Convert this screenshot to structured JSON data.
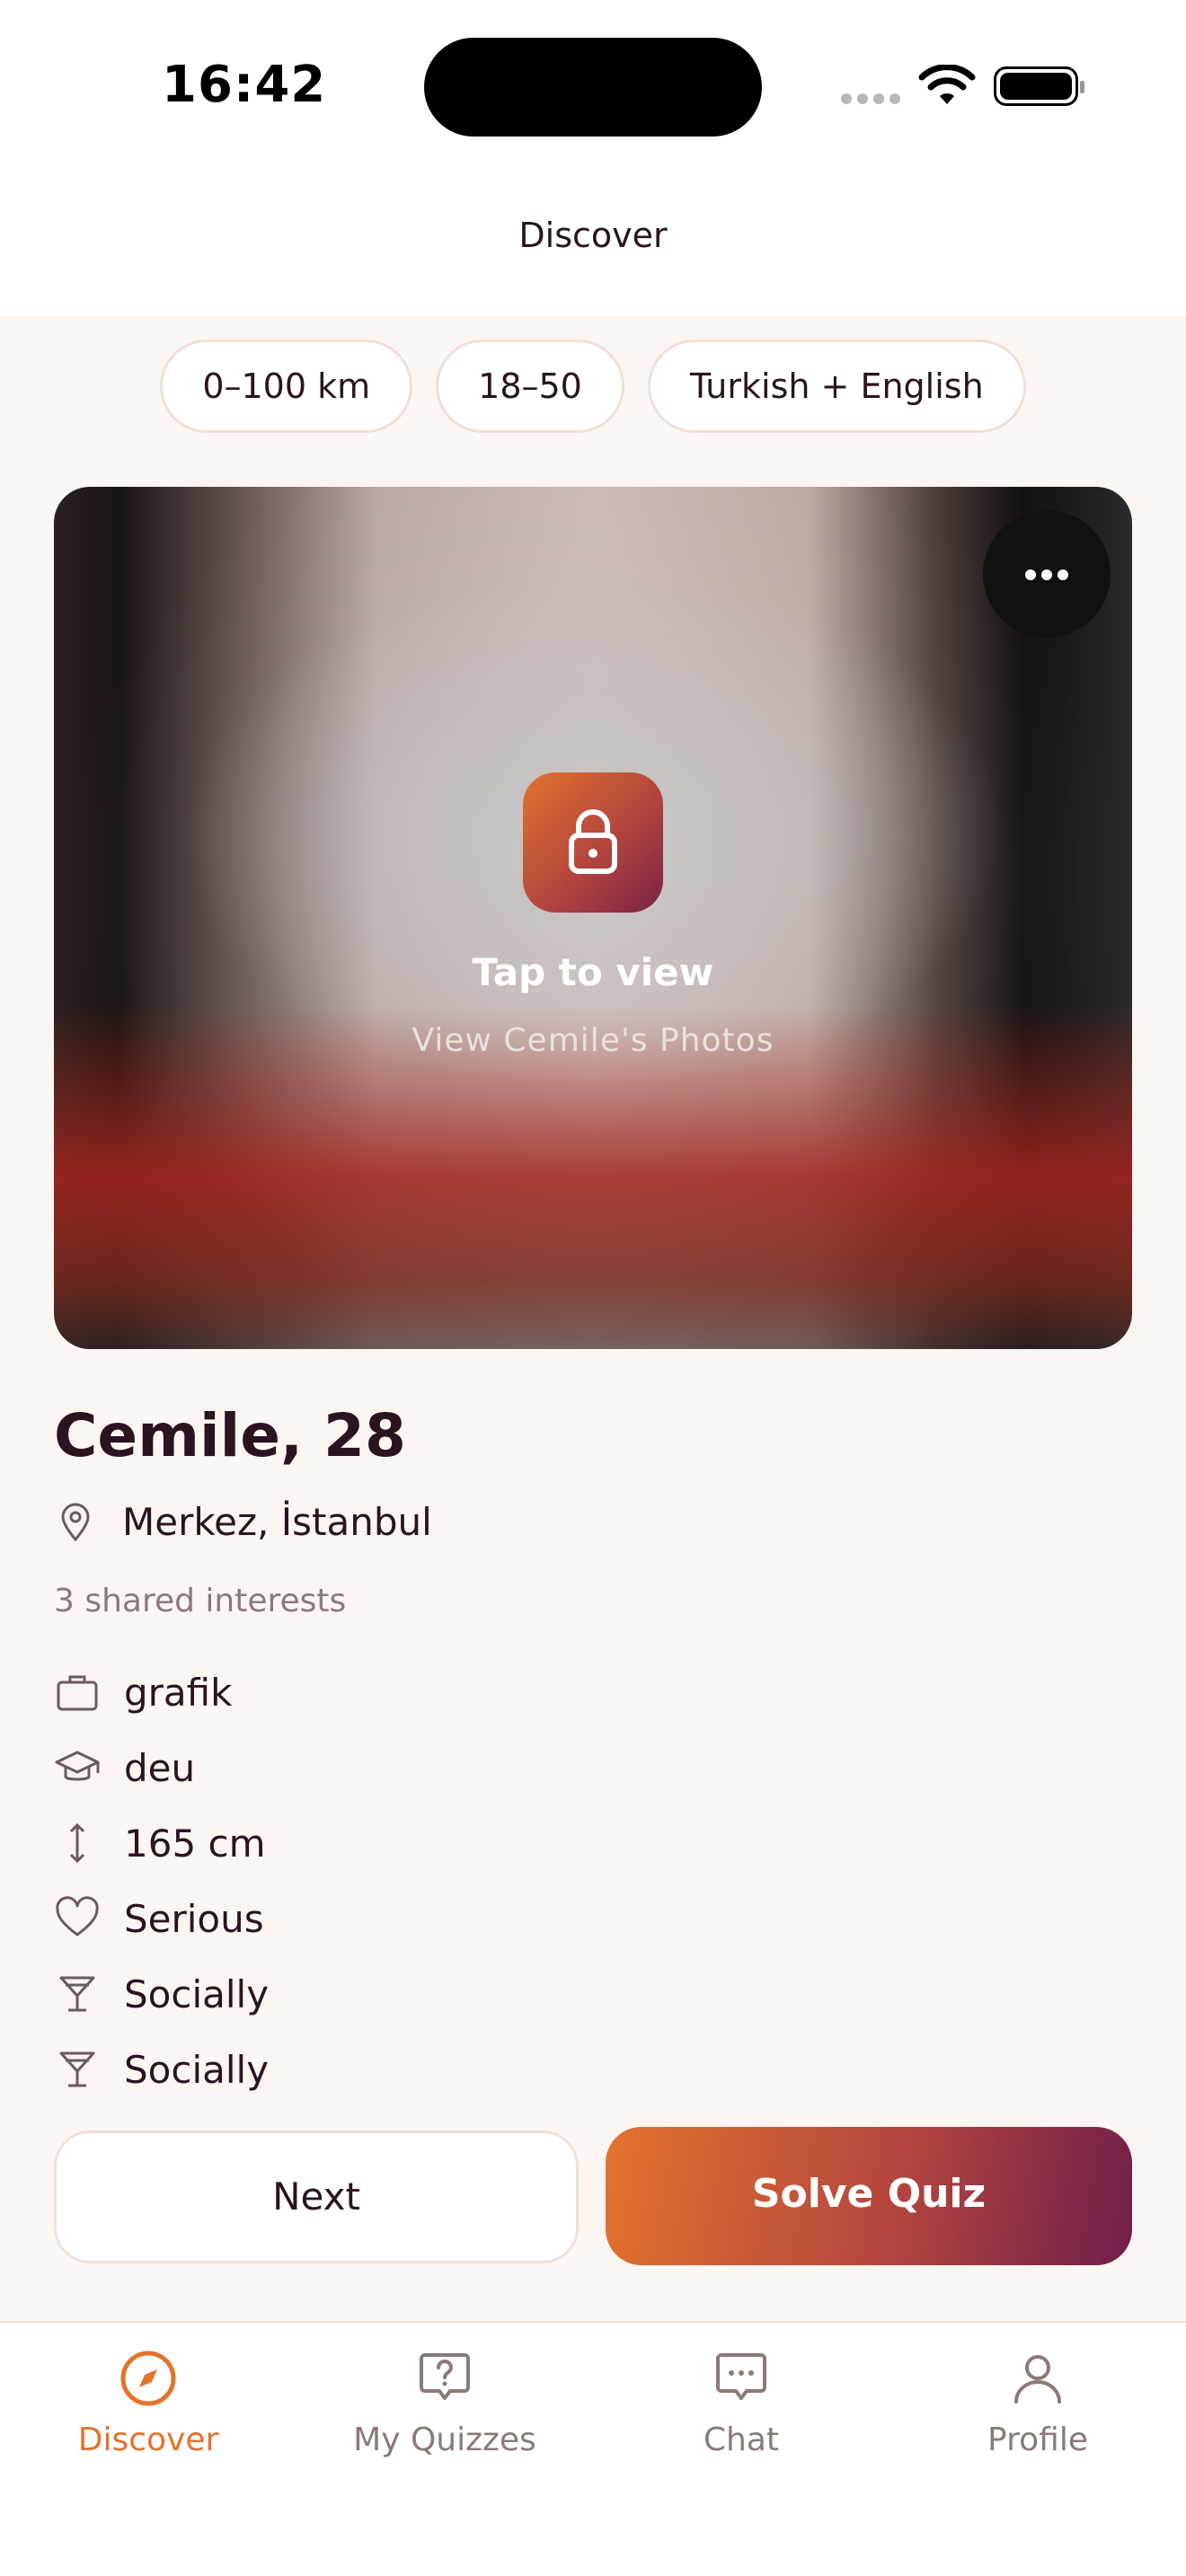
{
  "status_bar": {
    "time": "16:42"
  },
  "nav": {
    "title": "Discover"
  },
  "filters": [
    {
      "label": "0–100 km"
    },
    {
      "label": "18–50"
    },
    {
      "label": "Turkish + English"
    }
  ],
  "photo_card": {
    "locked_title": "Tap to view",
    "locked_subtitle": "View Cemile's Photos",
    "more_icon": "more-horizontal-icon",
    "lock_icon": "lock-icon"
  },
  "profile": {
    "name_age": "Cemile, 28",
    "location": "Merkez, İstanbul",
    "shared_interests": "3 shared interests",
    "details": [
      {
        "icon": "briefcase-icon",
        "value": "grafik"
      },
      {
        "icon": "graduation-cap-icon",
        "value": "deu"
      },
      {
        "icon": "height-arrows-icon",
        "value": "165 cm"
      },
      {
        "icon": "heart-icon",
        "value": "Serious"
      },
      {
        "icon": "cocktail-glass-icon",
        "value": "Socially"
      },
      {
        "icon": "cocktail-glass-icon",
        "value": "Socially"
      }
    ]
  },
  "actions": {
    "next_label": "Next",
    "quiz_label": "Solve Quiz"
  },
  "tabbar": {
    "items": [
      {
        "label": "Discover",
        "icon": "compass-icon",
        "active": true
      },
      {
        "label": "My Quizzes",
        "icon": "question-bubble-icon",
        "active": false
      },
      {
        "label": "Chat",
        "icon": "chat-bubble-icon",
        "active": false
      },
      {
        "label": "Profile",
        "icon": "person-icon",
        "active": false
      }
    ]
  },
  "colors": {
    "accent": "#e3732d",
    "accent_end": "#701e4c",
    "background": "#fcf6f2",
    "text": "#2a1420",
    "muted": "#8a7a78"
  }
}
